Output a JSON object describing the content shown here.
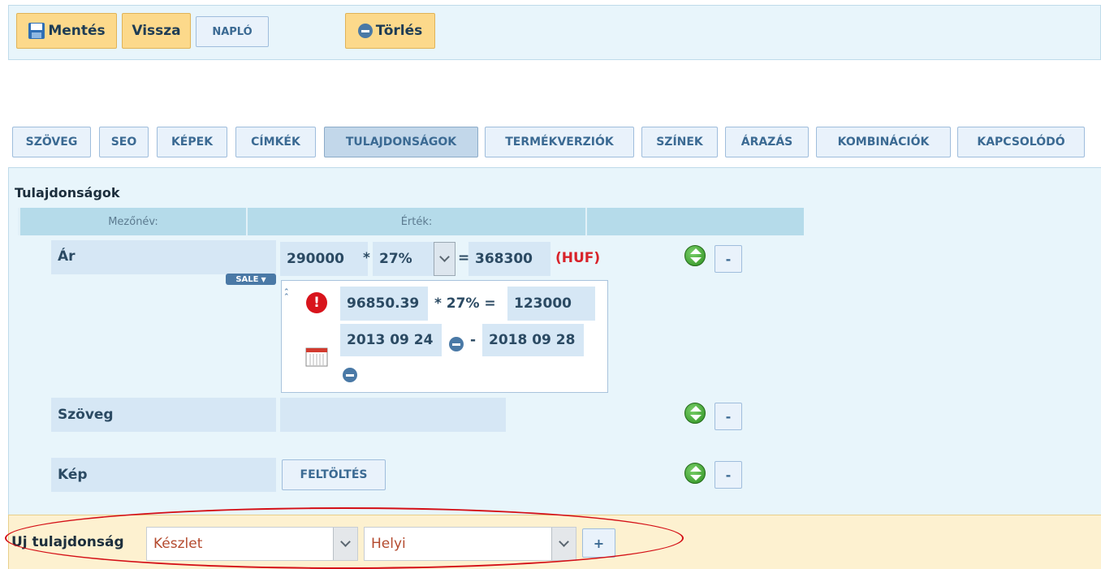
{
  "toolbar": {
    "save": "Mentés",
    "back": "Vissza",
    "log": "NAPLÓ",
    "delete": "Törlés"
  },
  "tabs": [
    {
      "label": "SZÖVEG"
    },
    {
      "label": "SEO"
    },
    {
      "label": "KÉPEK"
    },
    {
      "label": "CÍMKÉK"
    },
    {
      "label": "TULAJDONSÁGOK",
      "active": true
    },
    {
      "label": "TERMÉKVERZIÓK"
    },
    {
      "label": "SZÍNEK"
    },
    {
      "label": "ÁRAZÁS"
    },
    {
      "label": "KOMBINÁCIÓK"
    },
    {
      "label": "KAPCSOLÓDÓ"
    }
  ],
  "section_title": "Tulajdonságok",
  "table_header": {
    "field_name": "Mezőnév:",
    "value": "Érték:"
  },
  "price": {
    "label": "Ár",
    "net": "290000",
    "multiply": "*",
    "vat": "27%",
    "equals": "=",
    "gross": "368300",
    "currency": "(HUF)",
    "sale_badge": "SALE",
    "sale": {
      "net": "96850.39",
      "expr": "* 27% =",
      "gross": "123000",
      "date_from": "2013 09 24",
      "dash": "-",
      "date_to": "2018 09 28"
    }
  },
  "text_field": {
    "label": "Szöveg",
    "value": ""
  },
  "image_field": {
    "label": "Kép",
    "upload": "FELTÖLTÉS"
  },
  "row_remove": "-",
  "new_property": {
    "label": "Uj tulajdonság",
    "type_select": "Készlet",
    "location_select": "Helyi",
    "add": "+"
  },
  "colors": {
    "accent_yellow": "#fcd98b",
    "panel_blue": "#e8f5fb",
    "highlight_red": "#d40f16",
    "currency_red": "#d8232a"
  }
}
